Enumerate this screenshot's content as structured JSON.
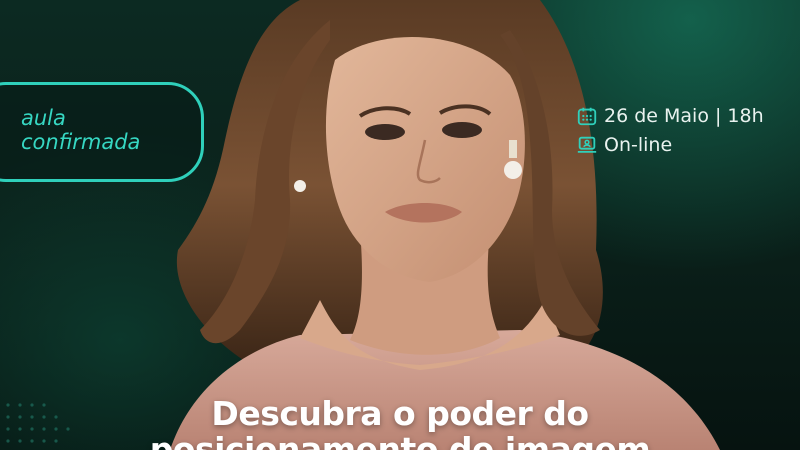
{
  "badge": {
    "line1": "aula",
    "line2": "confirmada"
  },
  "event": {
    "date": "26 de Maio | 18h",
    "date_icon": "calendar-icon",
    "location": "On-line",
    "location_icon": "computer-icon"
  },
  "headline": {
    "line1": "Descubra o poder do",
    "line2": "posicionamento de imagem"
  },
  "colors": {
    "accent": "#2fd0bb",
    "background": "#0a1f19",
    "text": "#ffffff"
  }
}
